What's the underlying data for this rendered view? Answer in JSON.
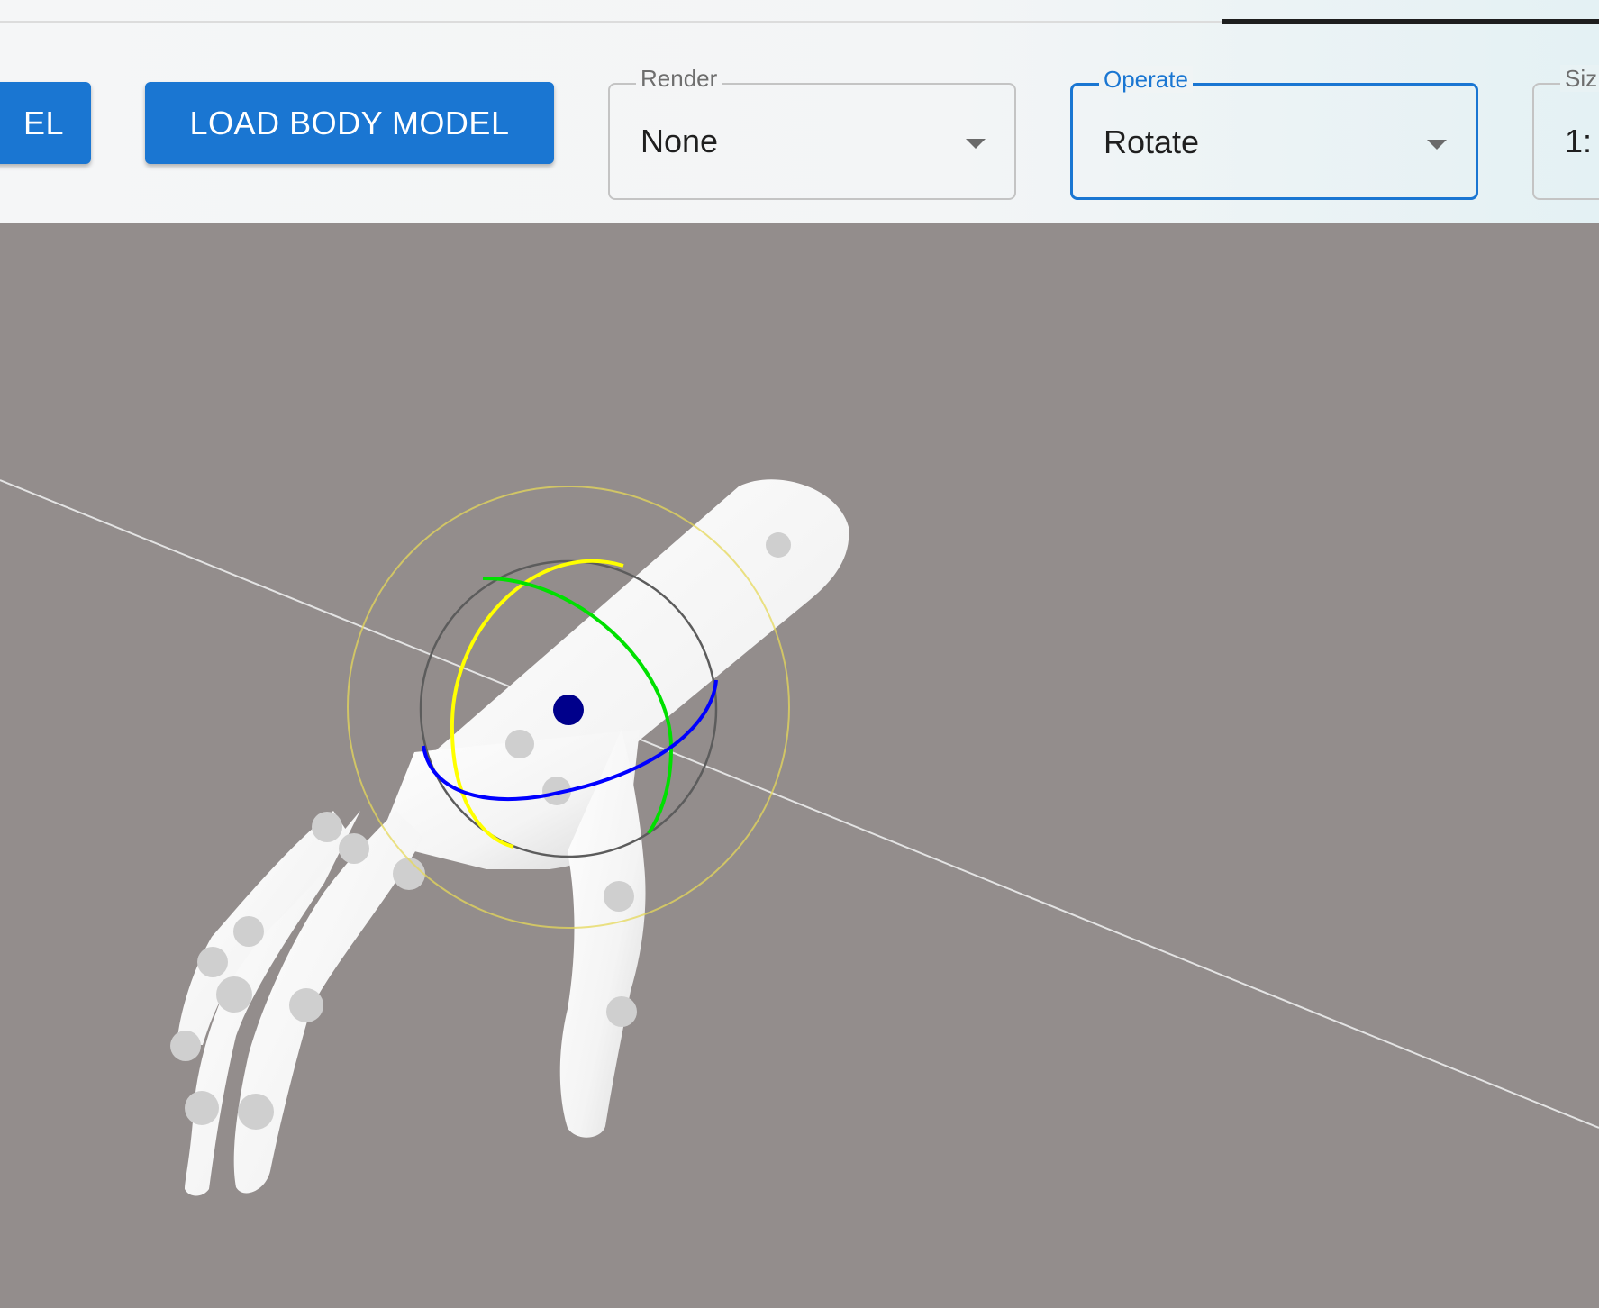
{
  "toolbar": {
    "load_model_label": "LOAD MODEL",
    "load_model_visible_text": "EL",
    "load_body_model_label": "LOAD BODY MODEL"
  },
  "render": {
    "label": "Render",
    "value": "None"
  },
  "operate": {
    "label": "Operate",
    "value": "Rotate"
  },
  "size": {
    "label": "Size",
    "label_visible": "Siz",
    "value_visible": "1:"
  },
  "colors": {
    "accent": "#1a76d2",
    "viewport_background": "#938d8c",
    "gizmo_x": "#ffff00",
    "gizmo_y": "#00e000",
    "gizmo_z": "#0000ff",
    "joint_selected": "#00008b"
  }
}
